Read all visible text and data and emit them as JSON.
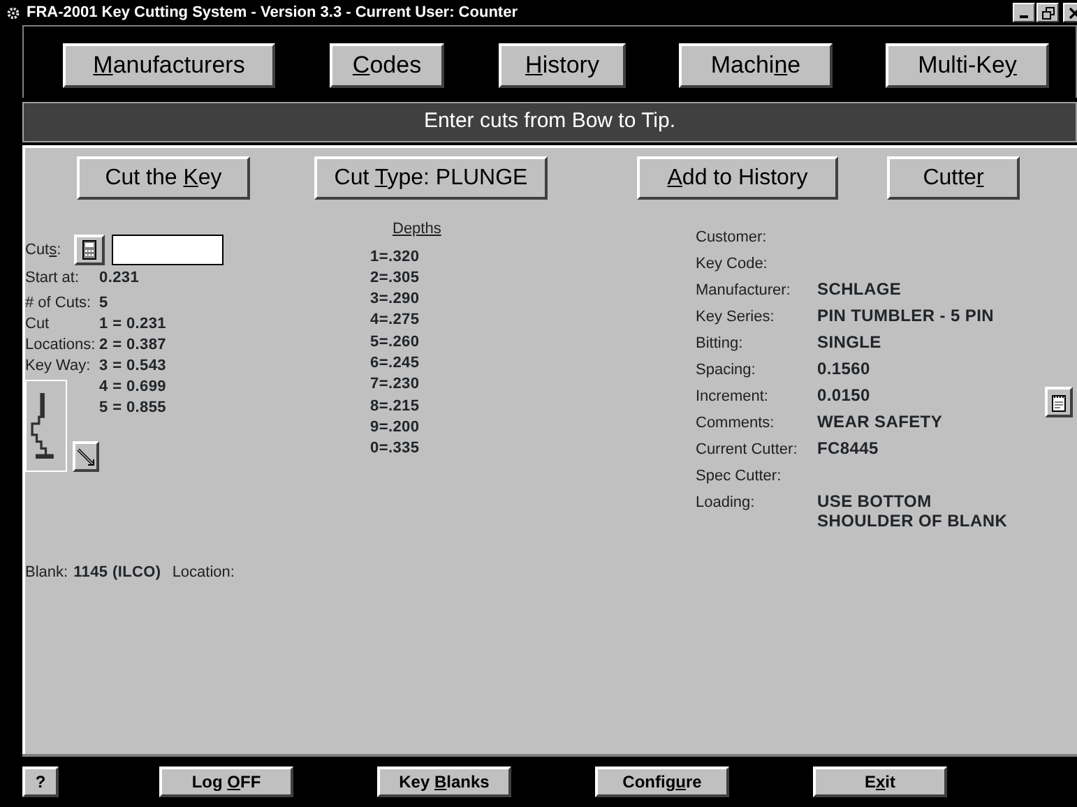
{
  "window": {
    "title": "FRA-2001 Key Cutting System - Version 3.3 - Current User: Counter"
  },
  "nav_buttons": [
    {
      "key": "M",
      "after": "anufacturers"
    },
    {
      "key": "C",
      "after": "odes"
    },
    {
      "key": "H",
      "after": "istory"
    },
    {
      "before": "Machi",
      "key": "n",
      "after": "e"
    },
    {
      "before": "Multi-Ke",
      "key": "y"
    }
  ],
  "banner": "Enter cuts from Bow to Tip.",
  "action_buttons": [
    {
      "before": "Cut the ",
      "key": "K",
      "after": "ey"
    },
    {
      "before": "Cut ",
      "key": "T",
      "after": "ype: PLUNGE"
    },
    {
      "key": "A",
      "after": "dd to History"
    },
    {
      "before": "Cutte",
      "key": "r"
    }
  ],
  "cuts": {
    "label": {
      "before": "Cut",
      "key": "s",
      "after": ":"
    }
  },
  "start_at": {
    "label": "Start at:",
    "value": "0.231"
  },
  "num_cuts": {
    "label": "# of Cuts:",
    "value": "5"
  },
  "cut_locations": {
    "labels": [
      "Cut",
      "Locations:",
      "Key Way:"
    ],
    "values": [
      "1 = 0.231",
      "2 = 0.387",
      "3 = 0.543",
      "4 = 0.699",
      "5 = 0.855"
    ]
  },
  "depths": {
    "title": "Depths",
    "values": [
      "1=.320",
      "2=.305",
      "3=.290",
      "4=.275",
      "5=.260",
      "6=.245",
      "7=.230",
      "8=.215",
      "9=.200",
      "0=.335"
    ]
  },
  "info": [
    {
      "label": "Customer:"
    },
    {
      "label": "Key Code:"
    },
    {
      "label": "Manufacturer:",
      "value": "SCHLAGE"
    },
    {
      "label": "Key Series:",
      "value": "PIN TUMBLER - 5 PIN"
    },
    {
      "label": "Bitting:",
      "value": "SINGLE"
    },
    {
      "label": "Spacing:",
      "value": "0.1560"
    },
    {
      "label": "Increment:",
      "value": "0.0150"
    },
    {
      "label": "Comments:",
      "value": "WEAR SAFETY"
    },
    {
      "label": "Current Cutter:",
      "value": "FC8445"
    },
    {
      "label": "Spec Cutter:"
    },
    {
      "label": "Loading:",
      "value": "USE BOTTOM SHOULDER OF BLANK"
    }
  ],
  "blank": {
    "label": "Blank:",
    "value": "1145 (ILCO)",
    "location_label": "Location:"
  },
  "help_button": "?",
  "footer_buttons": [
    {
      "before": "Log ",
      "key": "O",
      "after": "FF"
    },
    {
      "before": "Key ",
      "key": "B",
      "after": "lanks"
    },
    {
      "before": "Config",
      "key": "u",
      "after": "re"
    },
    {
      "before": "E",
      "key": "x",
      "after": "it"
    }
  ]
}
